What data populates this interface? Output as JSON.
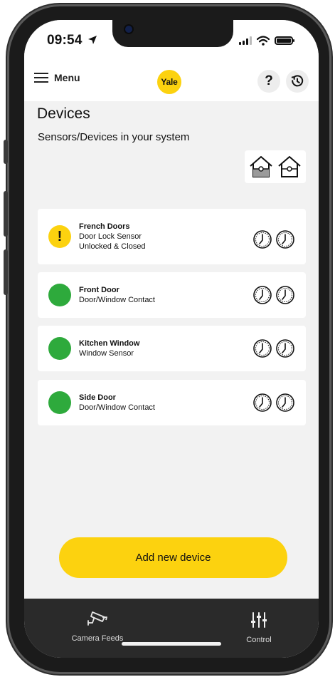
{
  "status_bar": {
    "time": "09:54"
  },
  "header": {
    "menu_label": "Menu",
    "logo_text": "Yale",
    "help_label": "?"
  },
  "page": {
    "title": "Devices",
    "subtitle": "Sensors/Devices in your system"
  },
  "devices": [
    {
      "name": "French Doors",
      "line1": "Door Lock Sensor",
      "line2": "Unlocked & Closed",
      "status": "warning",
      "status_symbol": "!"
    },
    {
      "name": "Front Door",
      "line1": "Door/Window Contact",
      "line2": "",
      "status": "ok"
    },
    {
      "name": "Kitchen Window",
      "line1": "Window Sensor",
      "line2": "",
      "status": "ok"
    },
    {
      "name": "Side Door",
      "line1": "Door/Window Contact",
      "line2": "",
      "status": "ok"
    }
  ],
  "actions": {
    "add_device_label": "Add new device"
  },
  "bottom_nav": [
    {
      "label": "Camera Feeds",
      "icon": "camera-icon"
    },
    {
      "label": "Control",
      "icon": "sliders-icon"
    }
  ],
  "colors": {
    "accent_yellow": "#fcd20f",
    "status_green": "#2eaa3c",
    "nav_background": "#2a2a2a",
    "page_background": "#f2f2f2"
  }
}
